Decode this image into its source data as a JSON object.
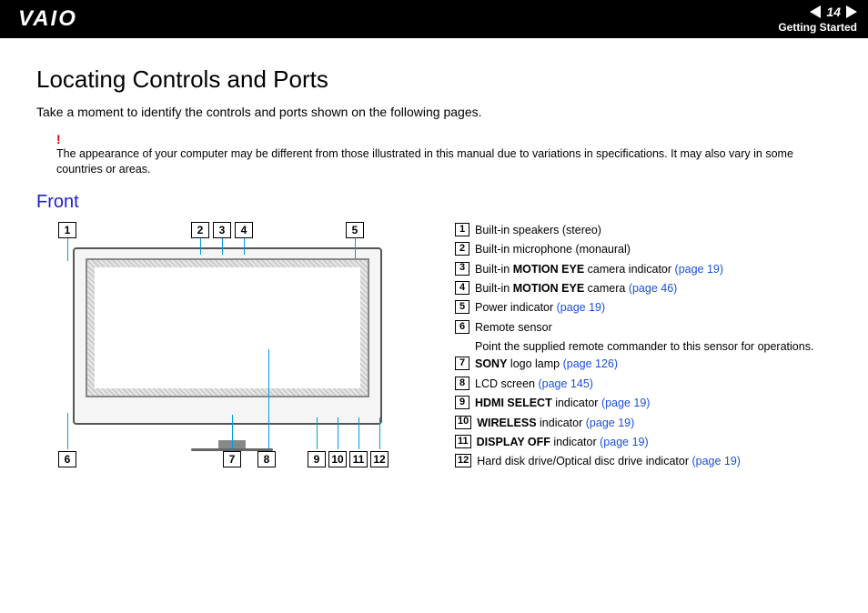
{
  "header": {
    "logo": "VAIO",
    "page_number": "14",
    "section": "Getting Started"
  },
  "page": {
    "title": "Locating Controls and Ports",
    "intro": "Take a moment to identify the controls and ports shown on the following pages.",
    "warning_mark": "!",
    "warning_text": "The appearance of your computer may be different from those illustrated in this manual due to variations in specifications. It may also vary in some countries or areas.",
    "subheading": "Front"
  },
  "diagram_labels": {
    "top": [
      "1",
      "2",
      "3",
      "4",
      "5"
    ],
    "bottom": [
      "6",
      "7",
      "8",
      "9",
      "10",
      "11",
      "12"
    ]
  },
  "legend": [
    {
      "num": "1",
      "parts": [
        {
          "t": "Built-in speakers (stereo)"
        }
      ]
    },
    {
      "num": "2",
      "parts": [
        {
          "t": "Built-in microphone (monaural)"
        }
      ]
    },
    {
      "num": "3",
      "parts": [
        {
          "t": "Built-in "
        },
        {
          "t": "MOTION EYE",
          "b": true
        },
        {
          "t": " camera indicator "
        },
        {
          "t": "(page 19)",
          "link": true
        }
      ]
    },
    {
      "num": "4",
      "parts": [
        {
          "t": "Built-in "
        },
        {
          "t": "MOTION EYE",
          "b": true
        },
        {
          "t": " camera "
        },
        {
          "t": "(page 46)",
          "link": true
        }
      ]
    },
    {
      "num": "5",
      "parts": [
        {
          "t": "Power indicator "
        },
        {
          "t": "(page 19)",
          "link": true
        }
      ]
    },
    {
      "num": "6",
      "parts": [
        {
          "t": "Remote sensor"
        }
      ],
      "sub": "Point the supplied remote commander to this sensor for operations."
    },
    {
      "num": "7",
      "parts": [
        {
          "t": "SONY",
          "b": true
        },
        {
          "t": " logo lamp "
        },
        {
          "t": "(page 126)",
          "link": true
        }
      ]
    },
    {
      "num": "8",
      "parts": [
        {
          "t": "LCD screen "
        },
        {
          "t": "(page 145)",
          "link": true
        }
      ]
    },
    {
      "num": "9",
      "parts": [
        {
          "t": "HDMI SELECT",
          "b": true
        },
        {
          "t": " indicator "
        },
        {
          "t": "(page 19)",
          "link": true
        }
      ]
    },
    {
      "num": "10",
      "parts": [
        {
          "t": "WIRELESS",
          "b": true
        },
        {
          "t": " indicator "
        },
        {
          "t": "(page 19)",
          "link": true
        }
      ]
    },
    {
      "num": "11",
      "parts": [
        {
          "t": "DISPLAY OFF",
          "b": true
        },
        {
          "t": " indicator "
        },
        {
          "t": "(page 19)",
          "link": true
        }
      ]
    },
    {
      "num": "12",
      "parts": [
        {
          "t": "Hard disk drive/Optical disc drive indicator "
        },
        {
          "t": "(page 19)",
          "link": true
        }
      ]
    }
  ]
}
